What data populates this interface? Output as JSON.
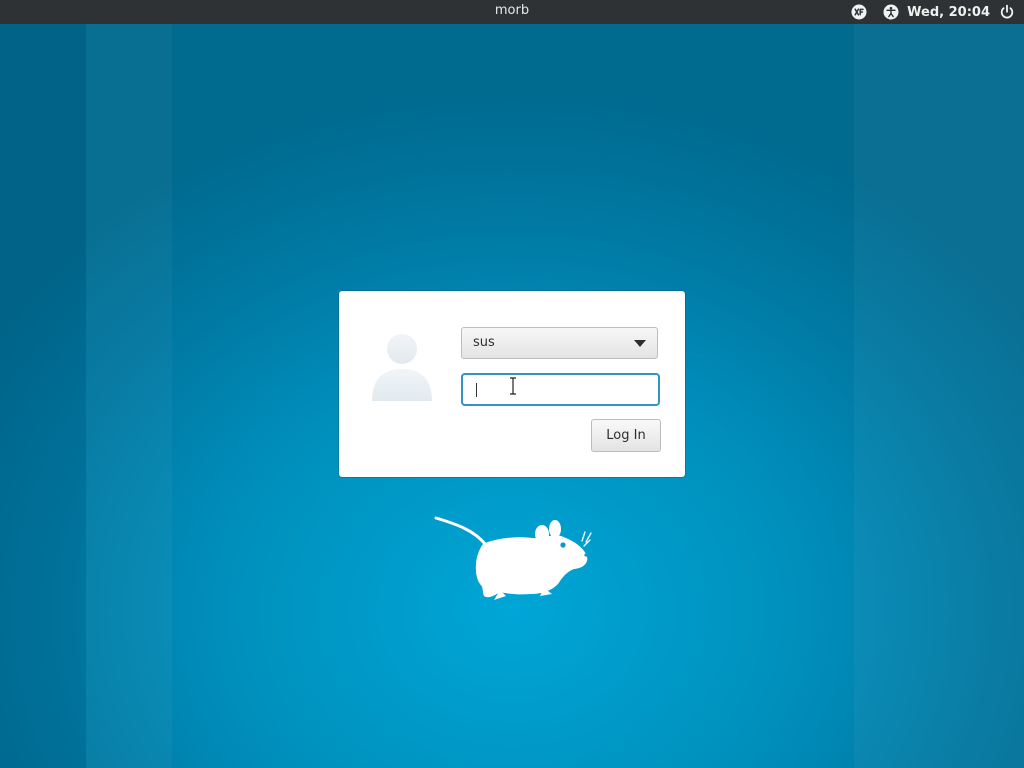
{
  "top_panel": {
    "host_name": "morb",
    "clock": "Wed, 20:04",
    "indicators": [
      "xfce-indicator-icon",
      "accessibility-icon",
      "power-icon"
    ]
  },
  "login": {
    "user_select": {
      "selected": "sus"
    },
    "password": {
      "value": ""
    },
    "login_button_label": "Log In"
  },
  "colors": {
    "panel_background": "#2e3234",
    "desktop_background": "#0090bd",
    "focus_ring": "#3592c4",
    "dialog_background": "#ffffff"
  },
  "icons": {
    "avatar": "user-silhouette-icon",
    "logo": "xfce-mouse-logo"
  }
}
